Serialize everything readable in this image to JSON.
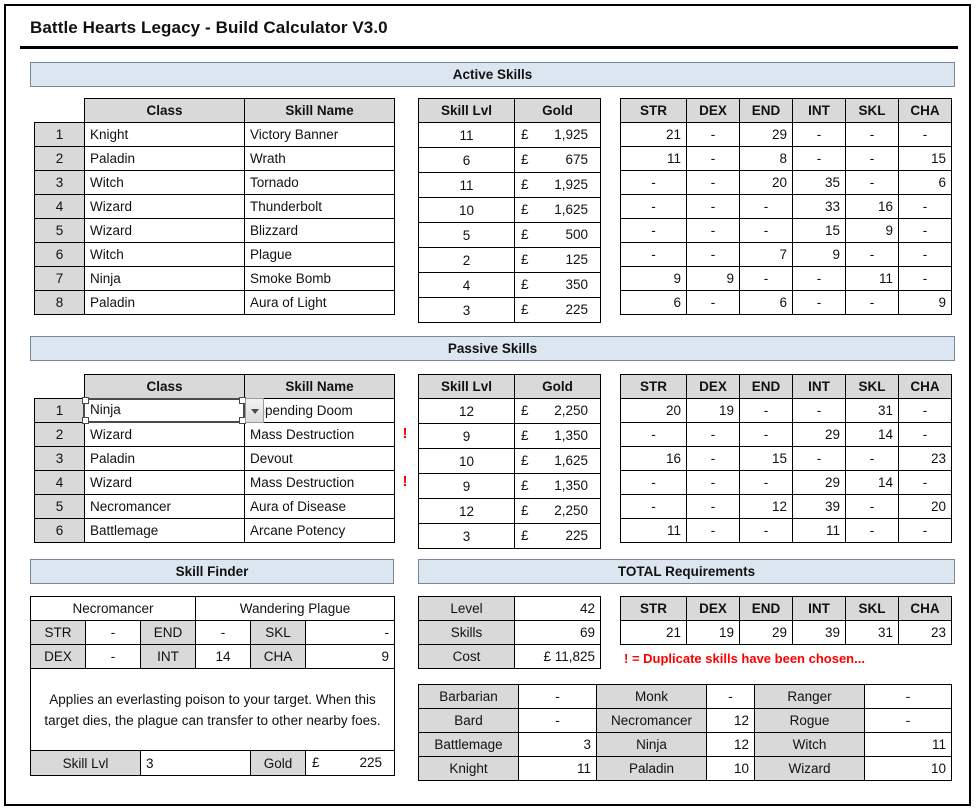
{
  "app": {
    "title": "Battle Hearts Legacy - Build Calculator V3.0"
  },
  "sections": {
    "active": "Active Skills",
    "passive": "Passive Skills",
    "skill_finder": "Skill Finder",
    "total": "TOTAL Requirements"
  },
  "headers": {
    "class": "Class",
    "skill_name": "Skill Name",
    "skill_lvl": "Skill Lvl",
    "gold": "Gold",
    "stats": [
      "STR",
      "DEX",
      "END",
      "INT",
      "SKL",
      "CHA"
    ]
  },
  "currency": "£",
  "active_skills": {
    "rows": [
      {
        "n": "1",
        "class": "Knight",
        "skill": "Victory Banner",
        "lvl": "11",
        "gold": "1,925",
        "stats": [
          "21",
          "-",
          "29",
          "-",
          "-",
          "-"
        ],
        "dup": ""
      },
      {
        "n": "2",
        "class": "Paladin",
        "skill": "Wrath",
        "lvl": "6",
        "gold": "675",
        "stats": [
          "11",
          "-",
          "8",
          "-",
          "-",
          "15"
        ],
        "dup": ""
      },
      {
        "n": "3",
        "class": "Witch",
        "skill": "Tornado",
        "lvl": "11",
        "gold": "1,925",
        "stats": [
          "-",
          "-",
          "20",
          "35",
          "-",
          "6"
        ],
        "dup": ""
      },
      {
        "n": "4",
        "class": "Wizard",
        "skill": "Thunderbolt",
        "lvl": "10",
        "gold": "1,625",
        "stats": [
          "-",
          "-",
          "-",
          "33",
          "16",
          "-"
        ],
        "dup": ""
      },
      {
        "n": "5",
        "class": "Wizard",
        "skill": "Blizzard",
        "lvl": "5",
        "gold": "500",
        "stats": [
          "-",
          "-",
          "-",
          "15",
          "9",
          "-"
        ],
        "dup": ""
      },
      {
        "n": "6",
        "class": "Witch",
        "skill": "Plague",
        "lvl": "2",
        "gold": "125",
        "stats": [
          "-",
          "-",
          "7",
          "9",
          "-",
          "-"
        ],
        "dup": ""
      },
      {
        "n": "7",
        "class": "Ninja",
        "skill": "Smoke Bomb",
        "lvl": "4",
        "gold": "350",
        "stats": [
          "9",
          "9",
          "-",
          "-",
          "11",
          "-"
        ],
        "dup": ""
      },
      {
        "n": "8",
        "class": "Paladin",
        "skill": "Aura of Light",
        "lvl": "3",
        "gold": "225",
        "stats": [
          "6",
          "-",
          "6",
          "-",
          "-",
          "9"
        ],
        "dup": ""
      }
    ]
  },
  "passive_skills": {
    "rows": [
      {
        "n": "1",
        "class": "Ninja",
        "skill": "Impending Doom",
        "lvl": "12",
        "gold": "2,250",
        "stats": [
          "20",
          "19",
          "-",
          "-",
          "31",
          "-"
        ],
        "dup": ""
      },
      {
        "n": "2",
        "class": "Wizard",
        "skill": "Mass Destruction",
        "lvl": "9",
        "gold": "1,350",
        "stats": [
          "-",
          "-",
          "-",
          "29",
          "14",
          "-"
        ],
        "dup": "!"
      },
      {
        "n": "3",
        "class": "Paladin",
        "skill": "Devout",
        "lvl": "10",
        "gold": "1,625",
        "stats": [
          "16",
          "-",
          "15",
          "-",
          "-",
          "23"
        ],
        "dup": ""
      },
      {
        "n": "4",
        "class": "Wizard",
        "skill": "Mass Destruction",
        "lvl": "9",
        "gold": "1,350",
        "stats": [
          "-",
          "-",
          "-",
          "29",
          "14",
          "-"
        ],
        "dup": "!"
      },
      {
        "n": "5",
        "class": "Necromancer",
        "skill": "Aura of Disease",
        "lvl": "12",
        "gold": "2,250",
        "stats": [
          "-",
          "-",
          "12",
          "39",
          "-",
          "20"
        ],
        "dup": ""
      },
      {
        "n": "6",
        "class": "Battlemage",
        "skill": "Arcane Potency",
        "lvl": "3",
        "gold": "225",
        "stats": [
          "11",
          "-",
          "-",
          "11",
          "-",
          "-"
        ],
        "dup": ""
      }
    ],
    "selected_cell": {
      "value": "Ninja",
      "row": "1"
    }
  },
  "skill_finder": {
    "class_name": "Necromancer",
    "skill_name": "Wandering Plague",
    "stats": [
      {
        "label": "STR",
        "value": "-"
      },
      {
        "label": "END",
        "value": "-"
      },
      {
        "label": "SKL",
        "value": "-"
      },
      {
        "label": "DEX",
        "value": "-"
      },
      {
        "label": "INT",
        "value": "14"
      },
      {
        "label": "CHA",
        "value": "9"
      }
    ],
    "description": "Applies an everlasting poison to your target. When this target dies, the plague can transfer to other nearby foes.",
    "skill_lvl_label": "Skill Lvl",
    "skill_lvl_value": "3",
    "gold_label": "Gold",
    "gold_symbol": "£",
    "gold_value": "225"
  },
  "totals": {
    "rows": [
      {
        "label": "Level",
        "value": "42"
      },
      {
        "label": "Skills",
        "value": "69"
      },
      {
        "label": "Cost",
        "value": "£ 11,825"
      }
    ],
    "stat_values": [
      "21",
      "19",
      "29",
      "39",
      "31",
      "23"
    ],
    "duplicate_note": "! = Duplicate skills have been chosen..."
  },
  "class_totals": [
    [
      {
        "name": "Barbarian",
        "value": "-"
      },
      {
        "name": "Monk",
        "value": "-"
      },
      {
        "name": "Ranger",
        "value": "-"
      }
    ],
    [
      {
        "name": "Bard",
        "value": "-"
      },
      {
        "name": "Necromancer",
        "value": "12"
      },
      {
        "name": "Rogue",
        "value": "-"
      }
    ],
    [
      {
        "name": "Battlemage",
        "value": "3"
      },
      {
        "name": "Ninja",
        "value": "12"
      },
      {
        "name": "Witch",
        "value": "11"
      }
    ],
    [
      {
        "name": "Knight",
        "value": "11"
      },
      {
        "name": "Paladin",
        "value": "10"
      },
      {
        "name": "Wizard",
        "value": "10"
      }
    ]
  ],
  "colors": {
    "section_bar": "#dce6f1",
    "header_grey": "#d9d9d9",
    "warning": "#ff0000"
  }
}
